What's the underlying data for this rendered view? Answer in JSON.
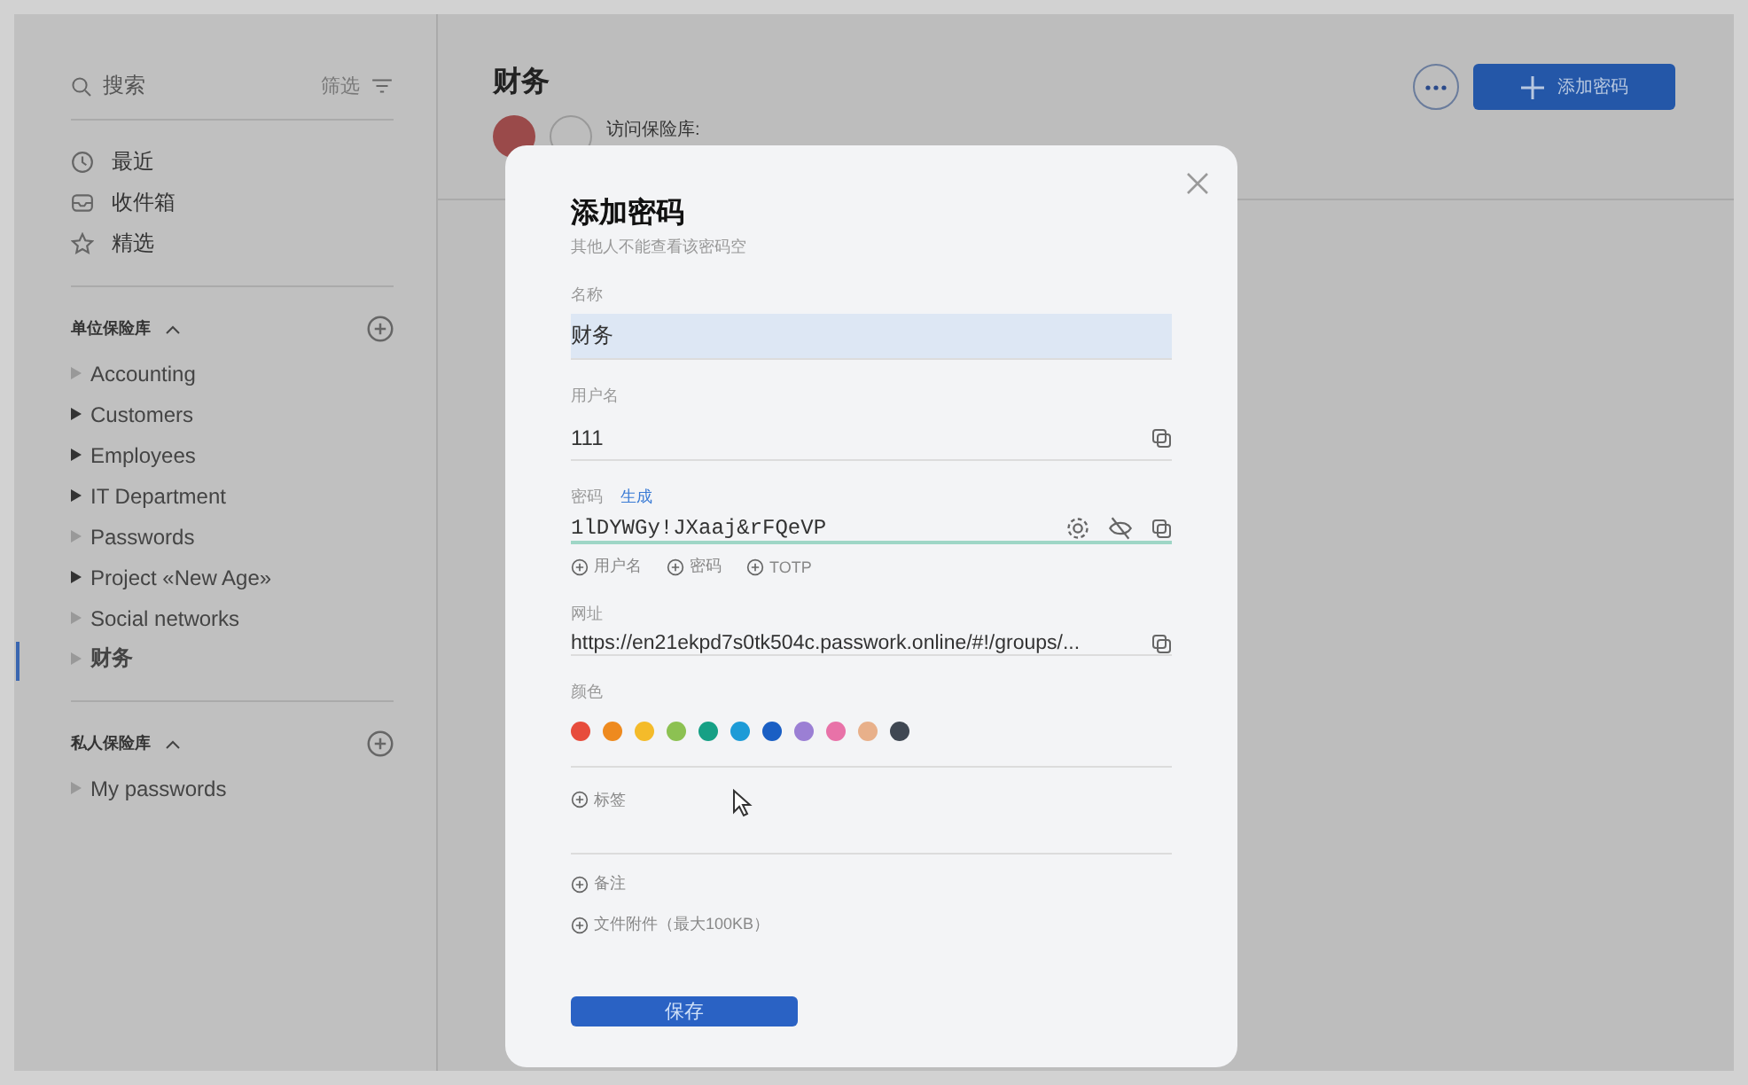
{
  "sidebar": {
    "search": {
      "placeholder": "搜索"
    },
    "filter": "筛选",
    "quick": [
      {
        "kind": "recent",
        "label": "最近"
      },
      {
        "kind": "inbox",
        "label": "收件箱"
      },
      {
        "kind": "starred",
        "label": "精选"
      }
    ],
    "sections": [
      {
        "title": "单位保险库",
        "expanded": true,
        "items": [
          {
            "label": "Accounting",
            "has_children": false,
            "selected": false
          },
          {
            "label": "Customers",
            "has_children": true,
            "selected": false
          },
          {
            "label": "Employees",
            "has_children": true,
            "selected": false
          },
          {
            "label": "IT Department",
            "has_children": true,
            "selected": false
          },
          {
            "label": "Passwords",
            "has_children": false,
            "selected": false
          },
          {
            "label": "Project «New Age»",
            "has_children": true,
            "selected": false
          },
          {
            "label": "Social networks",
            "has_children": false,
            "selected": false
          },
          {
            "label": "财务",
            "has_children": false,
            "selected": true
          }
        ]
      },
      {
        "title": "私人保险库",
        "expanded": true,
        "items": [
          {
            "label": "My passwords",
            "has_children": false,
            "selected": false
          }
        ]
      }
    ]
  },
  "main": {
    "title": "财务",
    "access_label": "访问保险库:",
    "add_button": "添加密码"
  },
  "dialog": {
    "title": "添加密码",
    "subtitle": "其他人不能查看该密码空",
    "fields": [
      {
        "label": "名称",
        "value": "财务",
        "focused": true
      },
      {
        "label": "用户名",
        "value": "111",
        "focused": false
      }
    ],
    "password": {
      "label": "密码",
      "generate": "生成",
      "value": "1lDYWGy!JXaaj&rFQeVP"
    },
    "add_links": [
      "用户名",
      "密码",
      "TOTP"
    ],
    "url": {
      "label": "网址",
      "value": "https://en21ekpd7s0tk504c.passwork.online/#!/groups/..."
    },
    "color_label": "颜色",
    "colors": [
      {
        "color": "#e74c3c"
      },
      {
        "color": "#ee8a1f"
      },
      {
        "color": "#f4bb2a"
      },
      {
        "color": "#8cc152"
      },
      {
        "color": "#16a085"
      },
      {
        "color": "#1d9bd7"
      },
      {
        "color": "#1a5fc4"
      },
      {
        "color": "#9b7fd4"
      },
      {
        "color": "#e872a8"
      },
      {
        "color": "#e8b08a"
      },
      {
        "color": "#3f4752"
      }
    ],
    "tags": "标签",
    "notes": "备注",
    "attachment": "文件附件（最大100KB）",
    "save": "保存"
  }
}
